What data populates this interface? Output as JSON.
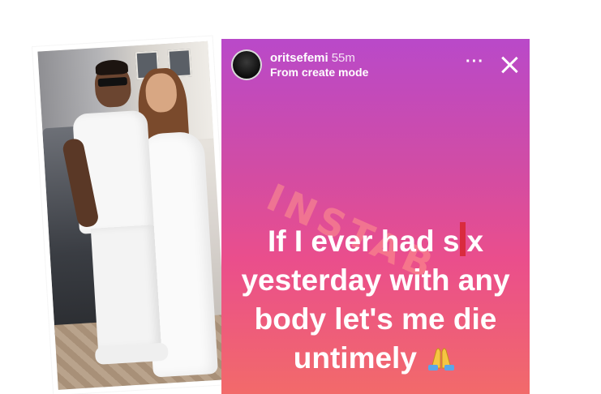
{
  "story": {
    "username": "oritsefemi",
    "time": "55m",
    "subtitle": "From create mode",
    "more_label": "···",
    "watermark": "INSTAB",
    "lines": [
      {
        "before": "If I ever had s",
        "after": "x"
      },
      "yesterday with any",
      "body let's me die",
      "untimely"
    ],
    "emoji": "folded-hands-emoji"
  },
  "colors": {
    "gradient_top": "#b949c9",
    "gradient_mid": "#ea4e8c",
    "gradient_bottom": "#f26a6a",
    "censor_bar": "#d92b3e"
  },
  "icons": {
    "close": "close-icon",
    "more": "more-dots-icon"
  }
}
